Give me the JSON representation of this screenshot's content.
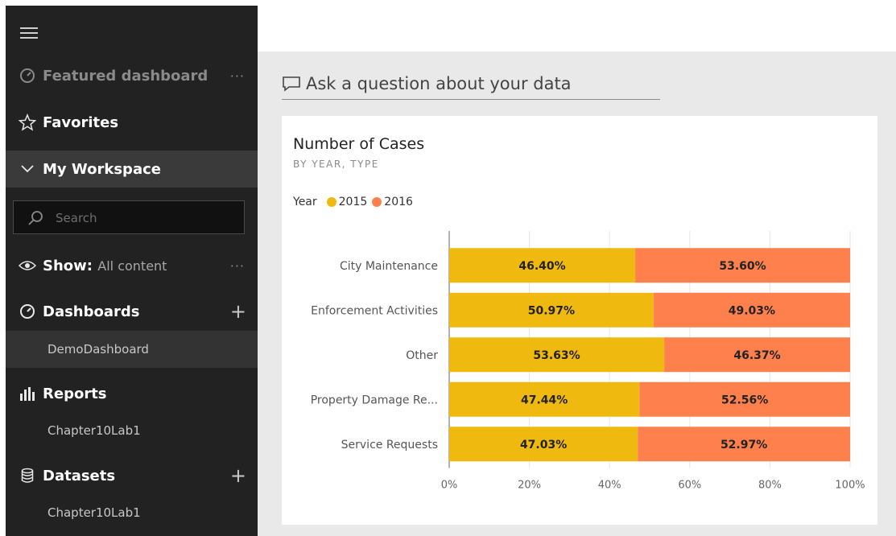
{
  "sidebar": {
    "featured": "Featured dashboard",
    "featured_more": "···",
    "favorites": "Favorites",
    "workspace": "My Workspace",
    "search_placeholder": "Search",
    "show_label": "Show:",
    "show_value": "All content",
    "show_more": "···",
    "dashboards": "Dashboards",
    "dashboards_add": "+",
    "dashboard_items": [
      "DemoDashboard"
    ],
    "reports": "Reports",
    "report_items": [
      "Chapter10Lab1"
    ],
    "datasets": "Datasets",
    "datasets_add": "+",
    "dataset_items": [
      "Chapter10Lab1"
    ]
  },
  "qa": {
    "placeholder": "Ask a question about your data"
  },
  "tile": {
    "title": "Number of Cases",
    "subtitle": "BY YEAR, TYPE"
  },
  "colors": {
    "sidebar_bg": "#222222",
    "series_2015": "#EFB90F",
    "series_2016": "#FD804D"
  },
  "chart_data": {
    "type": "bar",
    "orientation": "horizontal",
    "stacked": "100%",
    "legend_title": "Year",
    "legend_position": "top-left",
    "categories": [
      "City Maintenance",
      "Enforcement Activities",
      "Other",
      "Property Damage Re...",
      "Service Requests"
    ],
    "series": [
      {
        "name": "2015",
        "color": "#EFB90F",
        "values": [
          46.4,
          50.97,
          53.63,
          47.44,
          47.03
        ],
        "labels": [
          "46.40%",
          "50.97%",
          "53.63%",
          "47.44%",
          "47.03%"
        ]
      },
      {
        "name": "2016",
        "color": "#FD804D",
        "values": [
          53.6,
          49.03,
          46.37,
          52.56,
          52.97
        ],
        "labels": [
          "53.60%",
          "49.03%",
          "46.37%",
          "52.56%",
          "52.97%"
        ]
      }
    ],
    "x_ticks": [
      "0%",
      "20%",
      "40%",
      "60%",
      "80%",
      "100%"
    ],
    "xlim": [
      0,
      100
    ],
    "grid": true
  }
}
